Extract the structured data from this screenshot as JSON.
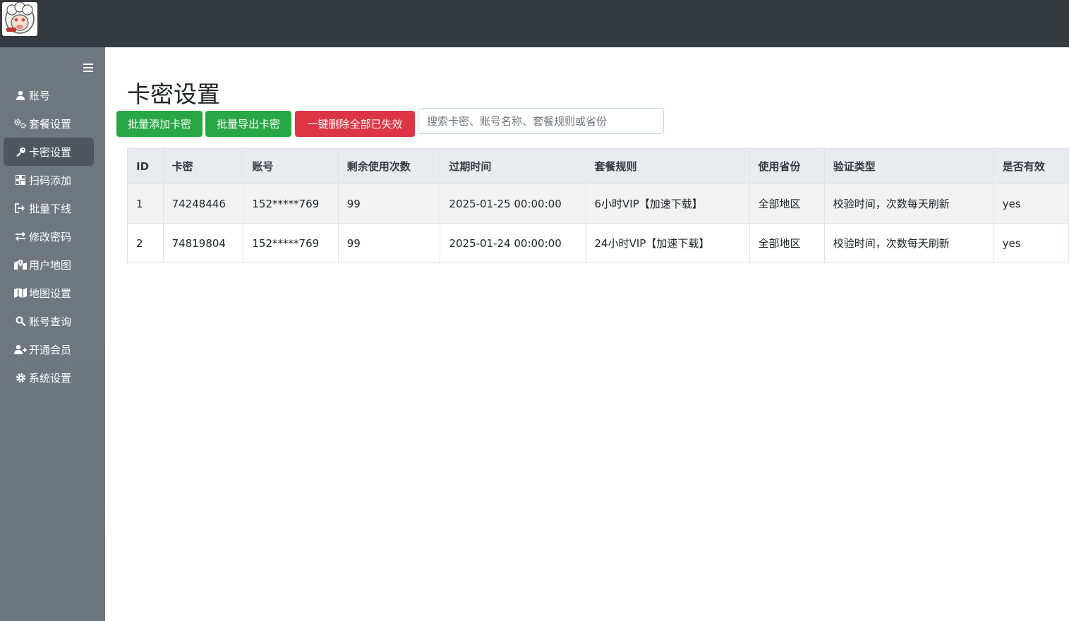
{
  "sidebar": {
    "items": [
      {
        "label": "账号",
        "icon": "user-icon",
        "active": false
      },
      {
        "label": "套餐设置",
        "icon": "cogs-icon",
        "active": false
      },
      {
        "label": "卡密设置",
        "icon": "key-icon",
        "active": true
      },
      {
        "label": "扫码添加",
        "icon": "qrcode-icon",
        "active": false
      },
      {
        "label": "批量下线",
        "icon": "sign-out-icon",
        "active": false
      },
      {
        "label": "修改密码",
        "icon": "exchange-icon",
        "active": false
      },
      {
        "label": "用户地图",
        "icon": "map-marked-icon",
        "active": false
      },
      {
        "label": "地图设置",
        "icon": "map-icon",
        "active": false
      },
      {
        "label": "账号查询",
        "icon": "search-icon",
        "active": false
      },
      {
        "label": "开通会员",
        "icon": "user-plus-icon",
        "active": false
      },
      {
        "label": "系统设置",
        "icon": "gear-icon",
        "active": false
      }
    ]
  },
  "main": {
    "title": "卡密设置",
    "buttons": {
      "batch_add": "批量添加卡密",
      "batch_export": "批量导出卡密",
      "delete_expired": "一键删除全部已失效"
    },
    "search": {
      "placeholder": "搜索卡密、账号名称、套餐规则或省份",
      "value": ""
    },
    "table": {
      "columns": [
        "ID",
        "卡密",
        "账号",
        "剩余使用次数",
        "过期时间",
        "套餐规则",
        "使用省份",
        "验证类型",
        "是否有效"
      ],
      "rows": [
        [
          "1",
          "74248446",
          "152*****769",
          "99",
          "2025-01-25 00:00:00",
          "6小时VIP【加速下载】",
          "全部地区",
          "校验时间，次数每天刷新",
          "yes"
        ],
        [
          "2",
          "74819804",
          "152*****769",
          "99",
          "2025-01-24 00:00:00",
          "24小时VIP【加速下载】",
          "全部地区",
          "校验时间，次数每天刷新",
          "yes"
        ]
      ]
    }
  },
  "colors": {
    "topbar": "#343a40",
    "sidebar": "#6c757d",
    "sidebar_active": "#4f565d",
    "success": "#28a745",
    "danger": "#dc3545"
  }
}
